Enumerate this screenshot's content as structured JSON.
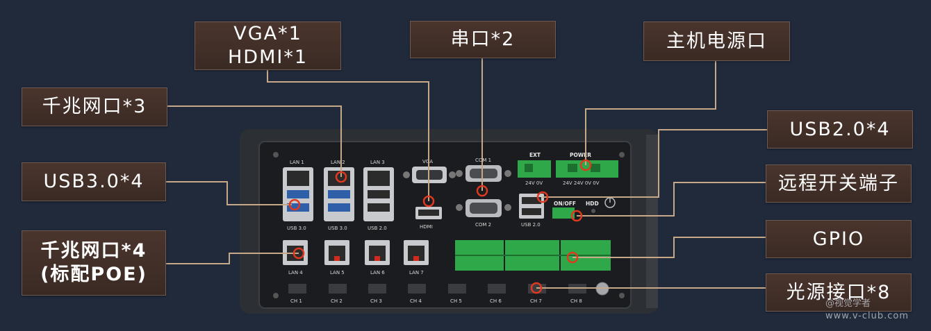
{
  "labels": {
    "vga_hdmi": {
      "line1": "VGA*1",
      "line2": "HDMI*1"
    },
    "serial": "串口*2",
    "power": "主机电源口",
    "lan3": "千兆网口*3",
    "usb2": "USB2.0*4",
    "usb3": "USB3.0*4",
    "remote_switch": "远程开关端子",
    "lan4_poe": {
      "line1": "千兆网口*4",
      "line2": "(标配POE)"
    },
    "gpio": "GPIO",
    "light": "光源接口*8"
  },
  "panel": {
    "lan_top": [
      "LAN 1",
      "LAN 2",
      "LAN 3"
    ],
    "usb_top": [
      "USB 3.0",
      "USB 3.0",
      "USB 2.0"
    ],
    "vga": "VGA",
    "hdmi": "HDMI",
    "com1": "COM 1",
    "com2": "COM 2",
    "ext": "EXT",
    "power": "POWER",
    "ext_volts": "24V  0V",
    "power_volts": "24V 24V  0V  0V",
    "onoff": "ON/OFF",
    "hdd": "HDD",
    "usb_mid": "USB 2.0",
    "lan_bottom": [
      "LAN 4",
      "LAN 5",
      "LAN 6",
      "LAN 7"
    ],
    "channels": [
      "CH 1",
      "CH 2",
      "CH 3",
      "CH 4",
      "CH 5",
      "CH 6",
      "CH 7",
      "CH 8"
    ]
  },
  "watermark": {
    "line1": "@视觉学者",
    "line2": "www.v-club.com"
  },
  "colors": {
    "background": "#202a3b",
    "label_fill": "#3f2e27",
    "leader": "#c7a98a",
    "marker": "#e0391f",
    "terminal_green": "#2fa84a"
  }
}
